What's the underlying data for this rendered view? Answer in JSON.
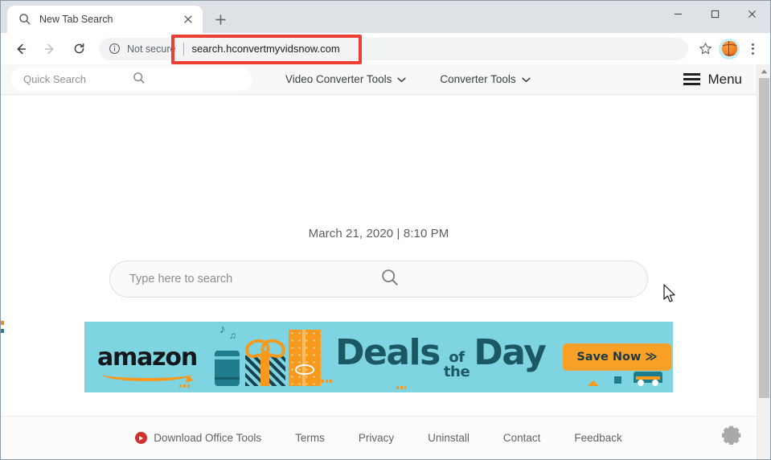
{
  "browser": {
    "tab": {
      "title": "New Tab Search",
      "favicon": "search-icon",
      "close": "×"
    },
    "new_tab_button": "+",
    "window_controls": {
      "minimize": "–",
      "maximize": "□",
      "close": "✕"
    },
    "nav": {
      "back": "←",
      "forward": "→",
      "reload": "⟳"
    },
    "omnibox": {
      "security_label": "Not secure",
      "url": "search.hconvertmyvidsnow.com",
      "info_icon": "info-circle-icon"
    },
    "bookmark_icon": "star-icon",
    "profile_icon": "basketball-avatar-icon",
    "menu_icon": "three-dot-menu-icon",
    "highlight_color": "#ee3f34"
  },
  "site_header": {
    "quick_search_placeholder": "Quick Search",
    "search_icon": "magnifier-icon",
    "nav_links": [
      {
        "label": "Video Converter Tools",
        "caret": "⌄"
      },
      {
        "label": "Converter Tools",
        "caret": "⌄"
      }
    ],
    "menu_label": "Menu",
    "menu_icon": "hamburger-icon"
  },
  "content": {
    "date": "March 21, 2020",
    "separator": "|",
    "time": "8:10 PM",
    "search_placeholder": "Type here to search",
    "search_icon": "magnifier-icon"
  },
  "banner": {
    "brand": "amazon",
    "headline": "Deals",
    "of": "of",
    "the": "the",
    "day": "Day",
    "cta": "Save Now ≫",
    "bg_color": "#7ed4e0",
    "text_color": "#1b5864",
    "cta_color": "#f9a026"
  },
  "footer": {
    "links": [
      {
        "label": "Download Office Tools",
        "icon": "youtube-play-icon"
      },
      {
        "label": "Terms",
        "icon": ""
      },
      {
        "label": "Privacy",
        "icon": ""
      },
      {
        "label": "Uninstall",
        "icon": ""
      },
      {
        "label": "Contact",
        "icon": ""
      },
      {
        "label": "Feedback",
        "icon": ""
      }
    ],
    "settings_icon": "gear-icon"
  }
}
